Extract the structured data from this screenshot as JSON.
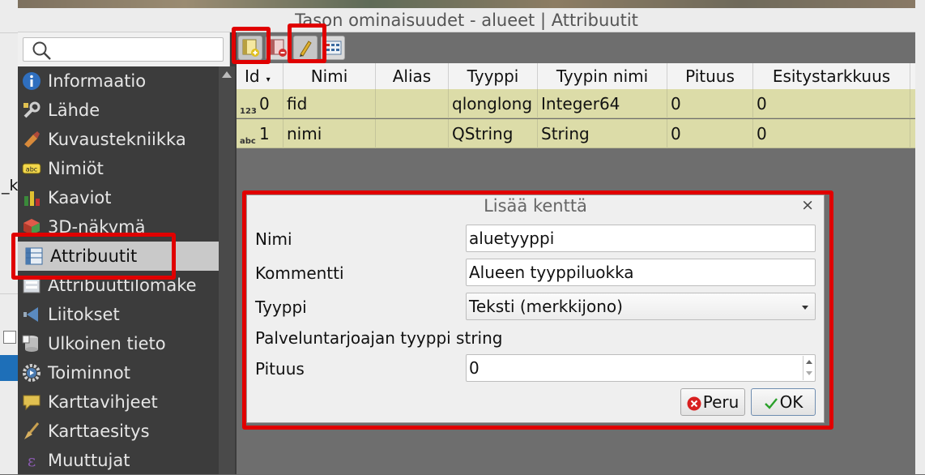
{
  "window": {
    "title": "Tason ominaisuudet - alueet | Attribuutit"
  },
  "background": {
    "left_text": "_kp"
  },
  "search": {
    "placeholder": ""
  },
  "sidebar": {
    "items": [
      {
        "label": "Informaatio",
        "icon": "info-icon"
      },
      {
        "label": "Lähde",
        "icon": "wrench-icon"
      },
      {
        "label": "Kuvaustekniikka",
        "icon": "paintbrush-icon"
      },
      {
        "label": "Nimiöt",
        "icon": "label-icon"
      },
      {
        "label": "Kaaviot",
        "icon": "diagram-icon"
      },
      {
        "label": "3D-näkymä",
        "icon": "cube-icon"
      },
      {
        "label": "Attribuutit",
        "icon": "table-icon",
        "active": true
      },
      {
        "label": "Attribuuttilomake",
        "icon": "form-icon"
      },
      {
        "label": "Liitokset",
        "icon": "join-icon"
      },
      {
        "label": "Ulkoinen tieto",
        "icon": "database-icon"
      },
      {
        "label": "Toiminnot",
        "icon": "gear-icon"
      },
      {
        "label": "Karttavihjeet",
        "icon": "speech-bubble-icon"
      },
      {
        "label": "Karttaesitys",
        "icon": "broom-icon"
      },
      {
        "label": "Muuttujat",
        "icon": "variable-icon"
      }
    ]
  },
  "table": {
    "columns": [
      "Id",
      "Nimi",
      "Alias",
      "Tyyppi",
      "Tyypin nimi",
      "Pituus",
      "Esitystarkkuus"
    ],
    "rows": [
      {
        "icon_text": "123",
        "id": "0",
        "nimi": "fid",
        "alias": "",
        "tyyppi": "qlonglong",
        "tyypin_nimi": "Integer64",
        "pituus": "0",
        "esitystarkkuus": "0"
      },
      {
        "icon_text": "abc",
        "id": "1",
        "nimi": "nimi",
        "alias": "",
        "tyyppi": "QString",
        "tyypin_nimi": "String",
        "pituus": "0",
        "esitystarkkuus": "0"
      }
    ]
  },
  "add_field": {
    "title": "Lisää kenttä",
    "close": "×",
    "name_label": "Nimi",
    "name_value": "aluetyyppi",
    "comment_label": "Kommentti",
    "comment_value": "Alueen tyyppiluokka",
    "type_label": "Tyyppi",
    "type_value": "Teksti (merkkijono)",
    "provider_type_label": "Palveluntarjoajan tyyppi string",
    "length_label": "Pituus",
    "length_value": "0",
    "cancel_label": "Peru",
    "ok_label": "OK"
  },
  "colors": {
    "highlight": "#e00000",
    "row_bg": "#dcdca8",
    "sidebar_bg": "#3c3c3c",
    "active_item_bg": "#c9c9c9"
  }
}
